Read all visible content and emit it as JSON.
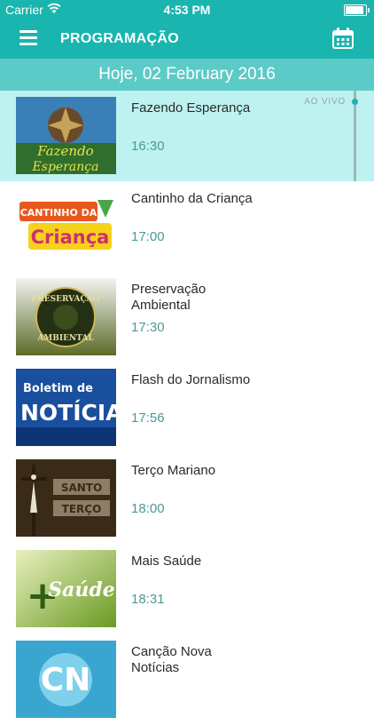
{
  "status_bar": {
    "carrier": "Carrier",
    "time": "4:53 PM",
    "battery_level": 1.0
  },
  "nav": {
    "title": "PROGRAMAÇÃO",
    "menu_icon": "hamburger-menu-icon",
    "calendar_icon": "calendar-icon"
  },
  "date_header": "Hoje, 02 February 2016",
  "live_label": "AO VIVO",
  "colors": {
    "primary": "#1ab5ae",
    "date_bar": "#5ccbc7",
    "live_row": "#bdf2f0",
    "time_text": "#4a9a96"
  },
  "programs": [
    {
      "title": "Fazendo Esperança",
      "time": "16:30",
      "thumb_text": [
        "Fazendo",
        "Esperança"
      ],
      "live": true
    },
    {
      "title": "Cantinho da Criança",
      "time": "17:00",
      "thumb_text": [
        "CANTINHO DA",
        "Criança"
      ],
      "live": false
    },
    {
      "title": "Preservação Ambiental",
      "time": "17:30",
      "thumb_text": [
        "PRESERVAÇÃO",
        "AMBIENTAL"
      ],
      "live": false
    },
    {
      "title": "Flash do Jornalismo",
      "time": "17:56",
      "thumb_text": [
        "Boletim de",
        "NOTÍCIAS"
      ],
      "live": false
    },
    {
      "title": "Terço Mariano",
      "time": "18:00",
      "thumb_text": [
        "SANTO",
        "TERÇO"
      ],
      "live": false
    },
    {
      "title": "Mais Saúde",
      "time": "18:31",
      "thumb_text": [
        "+",
        "Saúde"
      ],
      "live": false
    },
    {
      "title": "Canção Nova Notícias",
      "time": "",
      "thumb_text": [
        "CN"
      ],
      "live": false
    }
  ]
}
